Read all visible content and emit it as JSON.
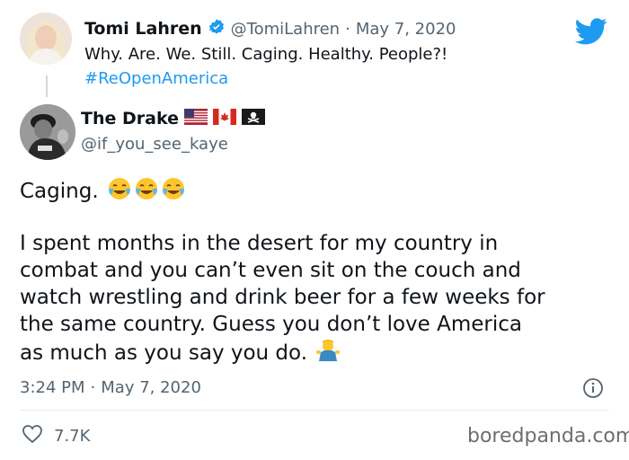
{
  "original_tweet": {
    "name": "Tomi Lahren",
    "handle": "@TomiLahren",
    "date": "May 7, 2020",
    "text": "Why. Are. We. Still. Caging. Healthy. People?!",
    "hashtag": "#ReOpenAmerica"
  },
  "reply_tweet": {
    "name": "The Drake",
    "handle": "@if_you_see_kaye",
    "line1": "Caging.",
    "paragraph_lines": [
      "I spent months in the desert for my country in",
      "combat and you can’t even sit on the couch and",
      "watch wrestling and drink beer for a few weeks for",
      "the same country. Guess you don’t love America",
      "as much as you say you do."
    ],
    "time": "3:24 PM",
    "date": "May 7, 2020",
    "likes": "7.7K"
  },
  "watermark": "boredpanda.com",
  "colors": {
    "twitter_blue": "#1d9bf0",
    "text_primary": "#0f1419",
    "text_secondary": "#536471"
  },
  "icons": {
    "brand": "twitter-bird-icon",
    "verified": "verified-badge-icon",
    "info": "info-icon",
    "like": "heart-icon"
  }
}
